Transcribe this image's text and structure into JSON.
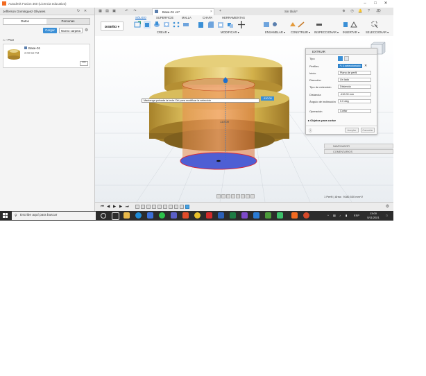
{
  "window": {
    "title": "Autodesk Fusion 360 (Licencia educativa)",
    "minimize": "–",
    "maximize": "□",
    "close": "✕"
  },
  "data_panel": {
    "user": "Jefferson Dominguez Olivares",
    "tabs": [
      "Datos",
      "Personas"
    ],
    "upload_label": "Cargar",
    "new_folder_label": "Nuevo carpeta",
    "breadcrumb": "PC3",
    "file": {
      "name": "Base-01",
      "date": "2:00:58 PM",
      "menu": "•••"
    }
  },
  "doc_tab": {
    "name": "Base-01 v4*",
    "offline": "Sin título*",
    "close": "×"
  },
  "ribbon": {
    "tabs": [
      "SÓLIDO",
      "SUPERFICIE",
      "MALLA",
      "CHAPA",
      "HERRAMIENTAS"
    ],
    "design_label": "DISEÑO ▾",
    "groups": [
      "CREAR ▾",
      "MODIFICAR ▾",
      "ENSAMBLAR ▾",
      "CONSTRUIR ▾",
      "INSPECCIONAR ▾",
      "INSERTAR ▾",
      "SELECCIONAR ▾"
    ]
  },
  "viewport": {
    "hint": "Mantenga pulsada la tecla Ctrl para modificar la selección",
    "dim_input": "-110.00",
    "dim_label": "110.00",
    "viewcube": "DERECHA",
    "status": "1 Perfil | Área : 9180.530 mm^2"
  },
  "extrude_dialog": {
    "title": "EXTRUIR",
    "rows": [
      {
        "label": "Tipo",
        "value": ""
      },
      {
        "label": "Perfiles",
        "value": "↖ 1 seleccionado"
      },
      {
        "label": "Inicio",
        "value": "Plano de perfil"
      },
      {
        "label": "Dirección",
        "value": "Un lado"
      },
      {
        "label": "Tipo de extensión",
        "value": "Distancia"
      },
      {
        "label": "Distancia",
        "value": "-110.00 mm"
      },
      {
        "label": "Ángulo de inclinación",
        "value": "0.0 deg"
      },
      {
        "label": "Operación",
        "value": "Cortar"
      }
    ],
    "section": "▸  Objetos para cortar",
    "ok": "Aceptar",
    "cancel": "Cancelar"
  },
  "browser_panels": {
    "navigator": "NAVEGADOR",
    "comments": "COMENTARIOS"
  },
  "timeline": {
    "controls": [
      "⏮",
      "◀",
      "▶",
      "▶",
      "⏭"
    ]
  },
  "taskbar": {
    "search_placeholder": "Escribe aquí para buscar",
    "language": "ESP",
    "time": "13:00",
    "date": "5/11/2021"
  },
  "colors": {
    "accent": "#3a8fd6",
    "fusion_orange": "#f26b21",
    "body_gold": "#c9a63a",
    "profile_blue": "#4e5fd4",
    "cut_red": "#e8673a"
  }
}
